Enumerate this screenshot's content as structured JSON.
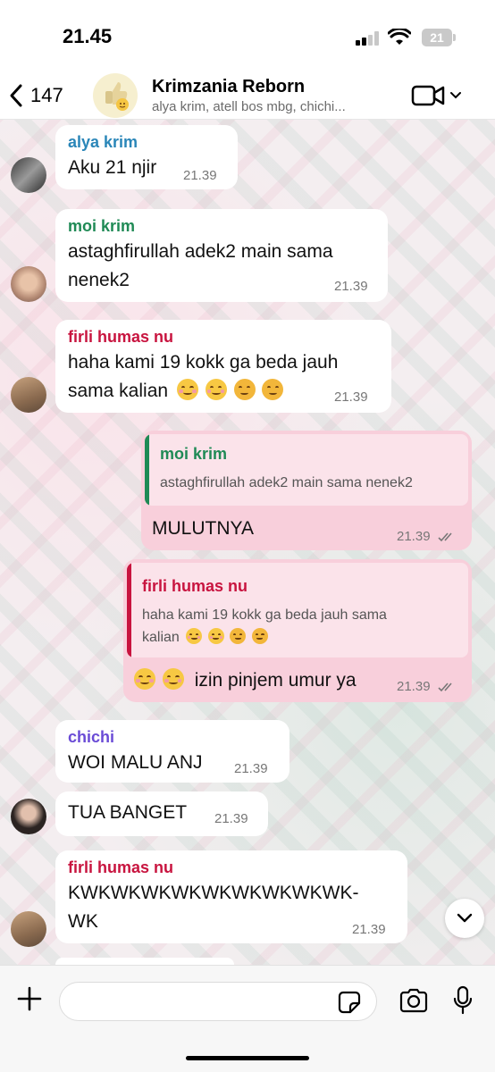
{
  "status": {
    "time": "21.45",
    "battery": "21"
  },
  "header": {
    "back_count": "147",
    "title": "Krimzania Reborn",
    "subtitle": "alya krim, atell bos mbg, chichi..."
  },
  "colors": {
    "alya": "#2a86b8",
    "moi": "#1f8a55",
    "firli": "#c8143f",
    "chichi": "#6a4bd6",
    "outgoing_bubble": "#f8cfdb",
    "incoming_bubble": "#ffffff"
  },
  "messages": [
    {
      "sender": "alya krim",
      "text": "Aku 21 njir",
      "time": "21.39"
    },
    {
      "sender": "moi krim",
      "text_line1": "astaghfirullah adek2 main sama",
      "text_line2": "nenek2",
      "time": "21.39"
    },
    {
      "sender": "firli humas nu",
      "text_line1": "haha kami 19 kokk ga beda jauh",
      "text_line2": "sama kalian",
      "emoji_names": [
        "smiling-face-icon",
        "smiling-face-icon",
        "hugging-face-icon",
        "hugging-face-icon"
      ],
      "time": "21.39"
    },
    {
      "quote_sender": "moi krim",
      "quote_text": "astaghfirullah adek2 main sama nenek2",
      "text": "MULUTNYA",
      "time": "21.39"
    },
    {
      "quote_sender": "firli humas nu",
      "quote_text_line1": "haha kami 19 kokk ga beda jauh sama",
      "quote_text_line2": "kalian",
      "text": "izin pinjem umur ya",
      "time": "21.39"
    },
    {
      "sender": "chichi",
      "text": "WOI MALU ANJ",
      "time": "21.39"
    },
    {
      "text": "TUA BANGET",
      "time": "21.39"
    },
    {
      "sender": "firli humas nu",
      "text_line1": "KWKWKWKWKWKWKWKWKWK-",
      "text_line2": "WK",
      "time": "21.39"
    }
  ],
  "input": {
    "placeholder": ""
  }
}
